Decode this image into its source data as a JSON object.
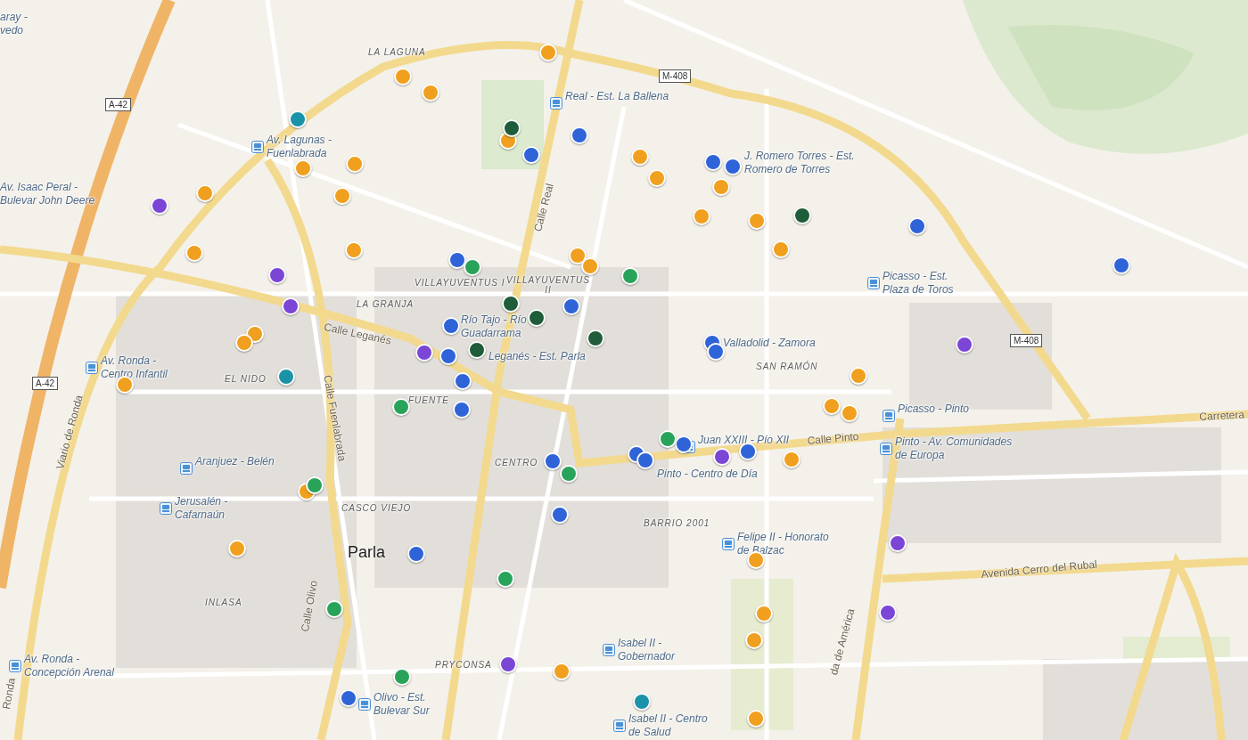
{
  "map": {
    "city": "Parla",
    "stops": [
      {
        "text": "aray -\nvedo",
        "icon": false
      },
      {
        "text": "Real - Est. La Ballena",
        "icon": true
      },
      {
        "text": "J. Romero Torres - Est.\nRomero de Torres",
        "icon": false
      },
      {
        "text": "Av. Lagunas -\nFuenlabrada",
        "icon": true
      },
      {
        "text": "Av. Isaac Peral -\nBulevar John Deere",
        "icon": false
      },
      {
        "text": "Picasso - Est.\nPlaza de Toros",
        "icon": true
      },
      {
        "text": "Río Tajo - Río\nGuadarrama",
        "icon": false
      },
      {
        "text": "Leganés - Est. Parla",
        "icon": false
      },
      {
        "text": "Valladolid - Zamora",
        "icon": false
      },
      {
        "text": "Av. Ronda -\nCentro Infantil",
        "icon": true
      },
      {
        "text": "Picasso - Pinto",
        "icon": true
      },
      {
        "text": "Juan XXIII - Pío XII",
        "icon": true
      },
      {
        "text": "Pinto - Centro de Día",
        "icon": false
      },
      {
        "text": "Pinto - Av. Comunidades\nde Europa",
        "icon": true
      },
      {
        "text": "Aranjuez - Belén",
        "icon": true
      },
      {
        "text": "Jerusalén -\nCafarnaún",
        "icon": true
      },
      {
        "text": "Felipe II - Honorato\nde Balzac",
        "icon": true
      },
      {
        "text": "Isabel II -\nGobernador",
        "icon": true
      },
      {
        "text": "Av. Ronda -\nConcepción Arenal",
        "icon": true
      },
      {
        "text": "Olivo - Est.\nBulevar Sur",
        "icon": true
      },
      {
        "text": "Isabel II - Centro\nde Salud",
        "icon": true
      }
    ],
    "areas": [
      "LA LAGUNA",
      "VILLAYUVENTUS I",
      "VILLAYUVENTUS\nII",
      "LA GRANJA",
      "SAN RAMÓN",
      "EL NIDO",
      "FUENTE",
      "CENTRO",
      "CASCO VIEJO",
      "BARRIO 2001",
      "INLASA",
      "PRYCONSA"
    ],
    "streets": [
      "Calle Real",
      "Calle Leganés",
      "Calle Fuenlabrada",
      "Viario de Ronda",
      "Ronda",
      "Calle Olivo",
      "Calle Pinto",
      "Carretera",
      "Avenida Cerro del Rubal",
      "da de América"
    ],
    "road_shields": [
      "A-42",
      "A-42",
      "M-408",
      "M-408"
    ],
    "markers": [
      {
        "color": "#f0a01e"
      },
      {
        "color": "#f0a01e"
      },
      {
        "color": "#f0a01e"
      },
      {
        "color": "#f0a01e"
      },
      {
        "color": "#f0a01e"
      },
      {
        "color": "#f0a01e"
      },
      {
        "color": "#f0a01e"
      },
      {
        "color": "#f0a01e"
      },
      {
        "color": "#f0a01e"
      },
      {
        "color": "#f0a01e"
      },
      {
        "color": "#f0a01e"
      },
      {
        "color": "#f0a01e"
      },
      {
        "color": "#f0a01e"
      },
      {
        "color": "#f0a01e"
      },
      {
        "color": "#f0a01e"
      },
      {
        "color": "#f0a01e"
      },
      {
        "color": "#f0a01e"
      },
      {
        "color": "#f0a01e"
      },
      {
        "color": "#f0a01e"
      },
      {
        "color": "#f0a01e"
      },
      {
        "color": "#f0a01e"
      },
      {
        "color": "#f0a01e"
      },
      {
        "color": "#f0a01e"
      },
      {
        "color": "#f0a01e"
      },
      {
        "color": "#f0a01e"
      },
      {
        "color": "#f0a01e"
      },
      {
        "color": "#f0a01e"
      },
      {
        "color": "#f0a01e"
      },
      {
        "color": "#f0a01e"
      },
      {
        "color": "#f0a01e"
      },
      {
        "color": "#f0a01e"
      },
      {
        "color": "#f0a01e"
      },
      {
        "color": "#2f63d8"
      },
      {
        "color": "#2f63d8"
      },
      {
        "color": "#2f63d8"
      },
      {
        "color": "#2f63d8"
      },
      {
        "color": "#2f63d8"
      },
      {
        "color": "#2f63d8"
      },
      {
        "color": "#2f63d8"
      },
      {
        "color": "#2f63d8"
      },
      {
        "color": "#2f63d8"
      },
      {
        "color": "#2f63d8"
      },
      {
        "color": "#2f63d8"
      },
      {
        "color": "#2f63d8"
      },
      {
        "color": "#2f63d8"
      },
      {
        "color": "#2f63d8"
      },
      {
        "color": "#2f63d8"
      },
      {
        "color": "#2f63d8"
      },
      {
        "color": "#2f63d8"
      },
      {
        "color": "#2f63d8"
      },
      {
        "color": "#2f63d8"
      },
      {
        "color": "#2f63d8"
      },
      {
        "color": "#2f63d8"
      },
      {
        "color": "#2f63d8"
      },
      {
        "color": "#1f5c3a"
      },
      {
        "color": "#1f5c3a"
      },
      {
        "color": "#1f5c3a"
      },
      {
        "color": "#1f5c3a"
      },
      {
        "color": "#1f5c3a"
      },
      {
        "color": "#1f5c3a"
      },
      {
        "color": "#2aa35a"
      },
      {
        "color": "#2aa35a"
      },
      {
        "color": "#2aa35a"
      },
      {
        "color": "#2aa35a"
      },
      {
        "color": "#2aa35a"
      },
      {
        "color": "#2aa35a"
      },
      {
        "color": "#2aa35a"
      },
      {
        "color": "#2aa35a"
      },
      {
        "color": "#2aa35a"
      },
      {
        "color": "#1a93a8"
      },
      {
        "color": "#1a93a8"
      },
      {
        "color": "#1a93a8"
      },
      {
        "color": "#7b45d6"
      },
      {
        "color": "#7b45d6"
      },
      {
        "color": "#7b45d6"
      },
      {
        "color": "#7b45d6"
      },
      {
        "color": "#7b45d6"
      },
      {
        "color": "#7b45d6"
      },
      {
        "color": "#7b45d6"
      },
      {
        "color": "#7b45d6"
      },
      {
        "color": "#7b45d6"
      }
    ]
  }
}
